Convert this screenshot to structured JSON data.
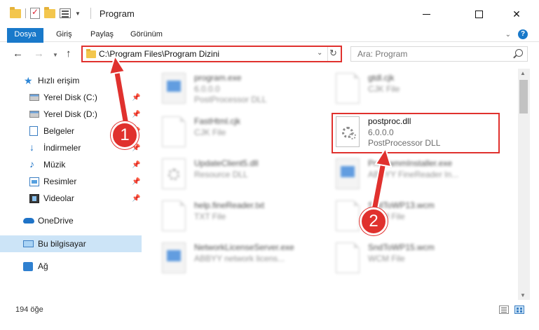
{
  "title": "Program",
  "ribbon": {
    "tabs": [
      "Dosya",
      "Giriş",
      "Paylaş",
      "Görünüm"
    ],
    "help": "?"
  },
  "address": {
    "path": "C:\\Program Files\\Program Dizini",
    "search_placeholder": "Ara: Program"
  },
  "sidebar": {
    "items": [
      {
        "label": "Hızlı erişim",
        "icon": "star-icon"
      },
      {
        "label": "Yerel Disk (C:)",
        "icon": "disk-icon",
        "pinned": true
      },
      {
        "label": "Yerel Disk (D:)",
        "icon": "disk-icon",
        "pinned": true
      },
      {
        "label": "Belgeler",
        "icon": "documents-icon",
        "pinned": true
      },
      {
        "label": "İndirmeler",
        "icon": "downloads-icon",
        "pinned": true
      },
      {
        "label": "Müzik",
        "icon": "music-icon",
        "pinned": true
      },
      {
        "label": "Resimler",
        "icon": "pictures-icon",
        "pinned": true
      },
      {
        "label": "Videolar",
        "icon": "videos-icon",
        "pinned": true
      },
      {
        "label": "OneDrive",
        "icon": "onedrive-icon"
      },
      {
        "label": "Bu bilgisayar",
        "icon": "this-pc-icon",
        "selected": true
      },
      {
        "label": "Ağ",
        "icon": "network-icon"
      }
    ]
  },
  "files": [
    {
      "name": "program.exe",
      "meta1": "6.0.0.0",
      "meta2": "PostProcessor DLL",
      "kind": "exe",
      "blurred": true
    },
    {
      "name": "gtdl.cjk",
      "meta1": "CJK File",
      "meta2": "",
      "kind": "page",
      "blurred": true
    },
    {
      "name": "FastHtml.cjk",
      "meta1": "CJK File",
      "meta2": "",
      "kind": "page",
      "blurred": true
    },
    {
      "name": "postproc.dll",
      "meta1": "6.0.0.0",
      "meta2": "PostProcessor DLL",
      "kind": "dll",
      "blurred": false
    },
    {
      "name": "UpdateClient5.dll",
      "meta1": "Resource DLL",
      "meta2": "",
      "kind": "dll",
      "blurred": true
    },
    {
      "name": "ProgrammInstaller.exe",
      "meta1": "ABBYY FineReader In...",
      "meta2": "",
      "kind": "exe",
      "blurred": true
    },
    {
      "name": "help.fineReader.txt",
      "meta1": "TXT File",
      "meta2": "",
      "kind": "page",
      "blurred": true
    },
    {
      "name": "SndToWP13.wcm",
      "meta1": "WCM File",
      "meta2": "",
      "kind": "page",
      "blurred": true
    },
    {
      "name": "NetworkLicenseServer.exe",
      "meta1": "ABBYY network licens...",
      "meta2": "",
      "kind": "exe",
      "blurred": true
    },
    {
      "name": "SndToWP15.wcm",
      "meta1": "WCM File",
      "meta2": "",
      "kind": "page",
      "blurred": true
    }
  ],
  "status": {
    "item_count": "194 öğe"
  },
  "annotations": {
    "step1": "1",
    "step2": "2",
    "accent_color": "#e0312e"
  },
  "colors": {
    "file_tab": "#1979ca",
    "selection": "#cce4f7"
  }
}
